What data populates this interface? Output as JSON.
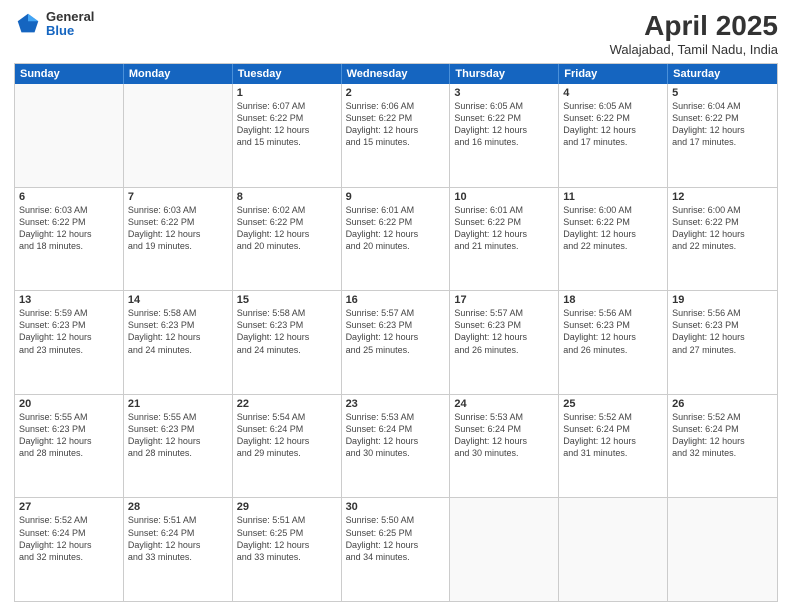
{
  "header": {
    "logo": {
      "general": "General",
      "blue": "Blue"
    },
    "title": "April 2025",
    "subtitle": "Walajabad, Tamil Nadu, India"
  },
  "days_of_week": [
    "Sunday",
    "Monday",
    "Tuesday",
    "Wednesday",
    "Thursday",
    "Friday",
    "Saturday"
  ],
  "weeks": [
    [
      {
        "day": "",
        "info": "",
        "empty": true
      },
      {
        "day": "",
        "info": "",
        "empty": true
      },
      {
        "day": "1",
        "info": "Sunrise: 6:07 AM\nSunset: 6:22 PM\nDaylight: 12 hours\nand 15 minutes."
      },
      {
        "day": "2",
        "info": "Sunrise: 6:06 AM\nSunset: 6:22 PM\nDaylight: 12 hours\nand 15 minutes."
      },
      {
        "day": "3",
        "info": "Sunrise: 6:05 AM\nSunset: 6:22 PM\nDaylight: 12 hours\nand 16 minutes."
      },
      {
        "day": "4",
        "info": "Sunrise: 6:05 AM\nSunset: 6:22 PM\nDaylight: 12 hours\nand 17 minutes."
      },
      {
        "day": "5",
        "info": "Sunrise: 6:04 AM\nSunset: 6:22 PM\nDaylight: 12 hours\nand 17 minutes."
      }
    ],
    [
      {
        "day": "6",
        "info": "Sunrise: 6:03 AM\nSunset: 6:22 PM\nDaylight: 12 hours\nand 18 minutes."
      },
      {
        "day": "7",
        "info": "Sunrise: 6:03 AM\nSunset: 6:22 PM\nDaylight: 12 hours\nand 19 minutes."
      },
      {
        "day": "8",
        "info": "Sunrise: 6:02 AM\nSunset: 6:22 PM\nDaylight: 12 hours\nand 20 minutes."
      },
      {
        "day": "9",
        "info": "Sunrise: 6:01 AM\nSunset: 6:22 PM\nDaylight: 12 hours\nand 20 minutes."
      },
      {
        "day": "10",
        "info": "Sunrise: 6:01 AM\nSunset: 6:22 PM\nDaylight: 12 hours\nand 21 minutes."
      },
      {
        "day": "11",
        "info": "Sunrise: 6:00 AM\nSunset: 6:22 PM\nDaylight: 12 hours\nand 22 minutes."
      },
      {
        "day": "12",
        "info": "Sunrise: 6:00 AM\nSunset: 6:22 PM\nDaylight: 12 hours\nand 22 minutes."
      }
    ],
    [
      {
        "day": "13",
        "info": "Sunrise: 5:59 AM\nSunset: 6:23 PM\nDaylight: 12 hours\nand 23 minutes."
      },
      {
        "day": "14",
        "info": "Sunrise: 5:58 AM\nSunset: 6:23 PM\nDaylight: 12 hours\nand 24 minutes."
      },
      {
        "day": "15",
        "info": "Sunrise: 5:58 AM\nSunset: 6:23 PM\nDaylight: 12 hours\nand 24 minutes."
      },
      {
        "day": "16",
        "info": "Sunrise: 5:57 AM\nSunset: 6:23 PM\nDaylight: 12 hours\nand 25 minutes."
      },
      {
        "day": "17",
        "info": "Sunrise: 5:57 AM\nSunset: 6:23 PM\nDaylight: 12 hours\nand 26 minutes."
      },
      {
        "day": "18",
        "info": "Sunrise: 5:56 AM\nSunset: 6:23 PM\nDaylight: 12 hours\nand 26 minutes."
      },
      {
        "day": "19",
        "info": "Sunrise: 5:56 AM\nSunset: 6:23 PM\nDaylight: 12 hours\nand 27 minutes."
      }
    ],
    [
      {
        "day": "20",
        "info": "Sunrise: 5:55 AM\nSunset: 6:23 PM\nDaylight: 12 hours\nand 28 minutes."
      },
      {
        "day": "21",
        "info": "Sunrise: 5:55 AM\nSunset: 6:23 PM\nDaylight: 12 hours\nand 28 minutes."
      },
      {
        "day": "22",
        "info": "Sunrise: 5:54 AM\nSunset: 6:24 PM\nDaylight: 12 hours\nand 29 minutes."
      },
      {
        "day": "23",
        "info": "Sunrise: 5:53 AM\nSunset: 6:24 PM\nDaylight: 12 hours\nand 30 minutes."
      },
      {
        "day": "24",
        "info": "Sunrise: 5:53 AM\nSunset: 6:24 PM\nDaylight: 12 hours\nand 30 minutes."
      },
      {
        "day": "25",
        "info": "Sunrise: 5:52 AM\nSunset: 6:24 PM\nDaylight: 12 hours\nand 31 minutes."
      },
      {
        "day": "26",
        "info": "Sunrise: 5:52 AM\nSunset: 6:24 PM\nDaylight: 12 hours\nand 32 minutes."
      }
    ],
    [
      {
        "day": "27",
        "info": "Sunrise: 5:52 AM\nSunset: 6:24 PM\nDaylight: 12 hours\nand 32 minutes."
      },
      {
        "day": "28",
        "info": "Sunrise: 5:51 AM\nSunset: 6:24 PM\nDaylight: 12 hours\nand 33 minutes."
      },
      {
        "day": "29",
        "info": "Sunrise: 5:51 AM\nSunset: 6:25 PM\nDaylight: 12 hours\nand 33 minutes."
      },
      {
        "day": "30",
        "info": "Sunrise: 5:50 AM\nSunset: 6:25 PM\nDaylight: 12 hours\nand 34 minutes."
      },
      {
        "day": "",
        "info": "",
        "empty": true
      },
      {
        "day": "",
        "info": "",
        "empty": true
      },
      {
        "day": "",
        "info": "",
        "empty": true
      }
    ]
  ]
}
